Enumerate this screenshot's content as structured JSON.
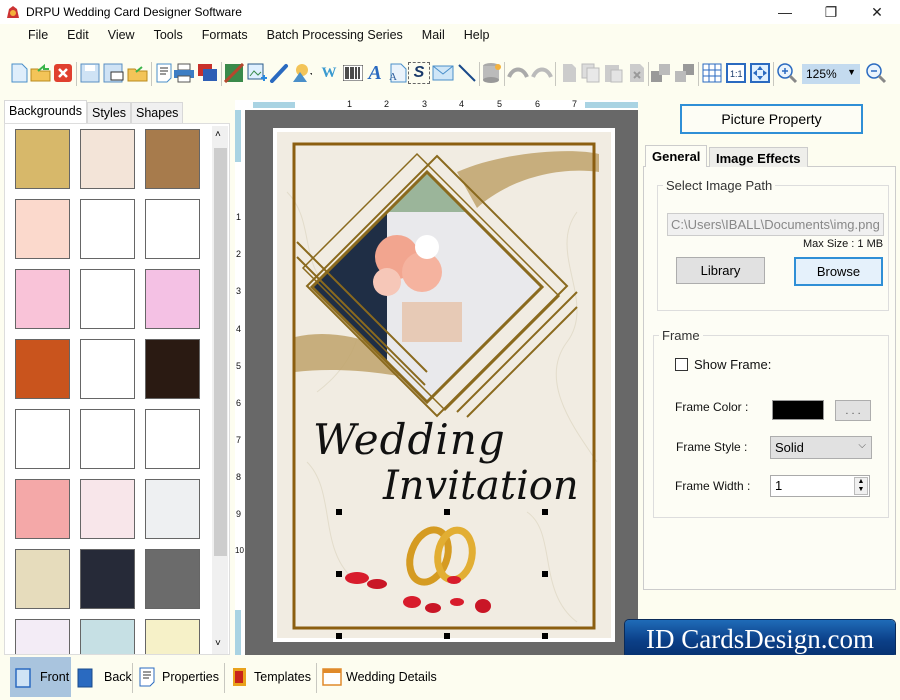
{
  "window": {
    "title": "DRPU Wedding Card Designer Software",
    "minimize": "—",
    "restore": "❐",
    "close": "✕"
  },
  "menu": [
    "File",
    "Edit",
    "View",
    "Tools",
    "Formats",
    "Batch Processing Series",
    "Mail",
    "Help"
  ],
  "toolbar": {
    "icons": [
      "new-icon",
      "open-icon",
      "close-doc-icon",
      "save-icon",
      "save-as-icon",
      "open-folder-icon",
      "properties-icon",
      "print-icon",
      "layers-icon",
      "background-icon",
      "insert-image-icon",
      "pen-icon",
      "shapes-icon",
      "watermark-icon",
      "barcode-icon",
      "text-icon",
      "word-art-icon",
      "signature-icon",
      "mail-icon",
      "line-icon",
      "database-icon",
      "undo-icon",
      "redo-icon",
      "cut-icon",
      "copy-icon",
      "paste-icon",
      "delete-icon",
      "bring-front-icon",
      "send-back-icon",
      "grid-icon",
      "actual-size-icon",
      "fit-window-icon",
      "zoom-in-icon",
      "zoom-out-icon"
    ],
    "zoom_value": "125%"
  },
  "left_panel": {
    "tabs": [
      "Backgrounds",
      "Styles",
      "Shapes"
    ],
    "active_tab": "Backgrounds",
    "thumbnails": [
      {
        "name": "golden-floral",
        "color": "#d7b86a"
      },
      {
        "name": "paisley",
        "color": "#f3e4d8"
      },
      {
        "name": "brown-tiles",
        "color": "#a77b4c"
      },
      {
        "name": "pink-flowers",
        "color": "#fbd9cc"
      },
      {
        "name": "heart-outlines",
        "color": "#ffffff"
      },
      {
        "name": "temple",
        "color": "#ffffff"
      },
      {
        "name": "pink-hearts",
        "color": "#f9c3d8"
      },
      {
        "name": "couples",
        "color": "#ffffff"
      },
      {
        "name": "pink-swirls",
        "color": "#f4c1e4"
      },
      {
        "name": "ganesha-orange",
        "color": "#c9541d"
      },
      {
        "name": "elephant-head",
        "color": "#ffffff"
      },
      {
        "name": "black-floral",
        "color": "#2a1a12"
      },
      {
        "name": "green-leaf",
        "color": "#ffffff"
      },
      {
        "name": "rose-petals",
        "color": "#ffffff"
      },
      {
        "name": "crescent-star",
        "color": "#ffffff"
      },
      {
        "name": "red-hearts",
        "color": "#f4a8a8"
      },
      {
        "name": "light-pink-lace",
        "color": "#f8e6ea"
      },
      {
        "name": "mandala",
        "color": "#eef0f2"
      },
      {
        "name": "white-rose",
        "color": "#e6dcbc"
      },
      {
        "name": "embroidery",
        "color": "#262a38"
      },
      {
        "name": "grey-lace",
        "color": "#6b6b6b"
      },
      {
        "name": "purple-flowers",
        "color": "#f3ecf6"
      },
      {
        "name": "blue-dots",
        "color": "#c6e0e4"
      },
      {
        "name": "yellow-border",
        "color": "#f6f1c8"
      }
    ]
  },
  "ruler": {
    "h": [
      "1",
      "2",
      "3",
      "4",
      "5",
      "6",
      "7"
    ],
    "v": [
      "1",
      "2",
      "3",
      "4",
      "5",
      "6",
      "7",
      "8",
      "9",
      "10"
    ]
  },
  "card": {
    "title_line1": "Wedding",
    "title_line2": "Invitation"
  },
  "right_panel": {
    "header": "Picture Property",
    "tabs": [
      "General",
      "Image Effects"
    ],
    "active_tab": "General",
    "image_path_group": "Select Image Path",
    "image_path": "C:\\Users\\IBALL\\Documents\\img.png",
    "max_size": "Max Size : 1 MB",
    "library_btn": "Library",
    "browse_btn": "Browse",
    "frame_group": "Frame",
    "show_frame_label": "Show Frame:",
    "show_frame_checked": false,
    "frame_color_label": "Frame Color :",
    "frame_color": "#000000",
    "color_picker_btn": ". . .",
    "frame_style_label": "Frame Style :",
    "frame_style": "Solid",
    "frame_width_label": "Frame Width :",
    "frame_width": "1"
  },
  "bottom_bar": [
    "Front",
    "Back",
    "Properties",
    "Templates",
    "Wedding Details"
  ],
  "active_view": "Front",
  "brand": "ID CardsDesign.com"
}
